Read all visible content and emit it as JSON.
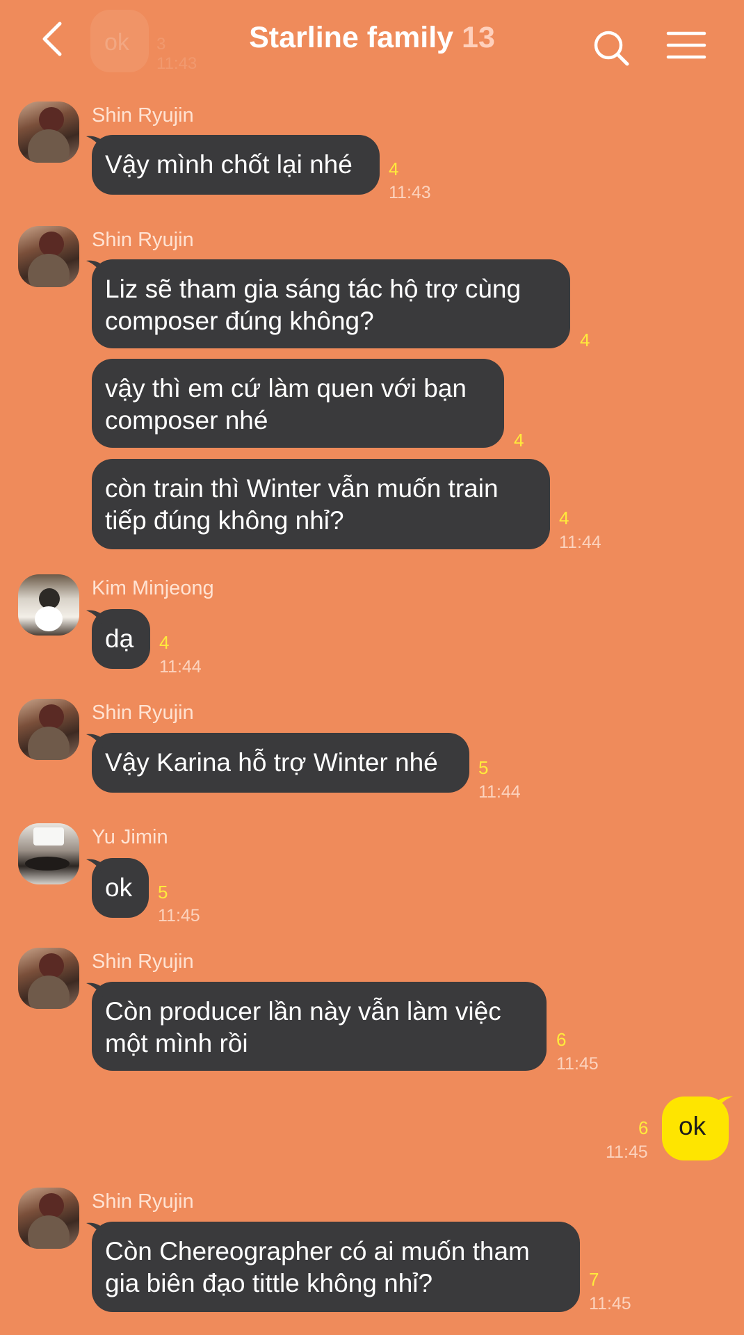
{
  "header": {
    "title": "Starline family",
    "member_count": "13",
    "ghost_bubble": "ok",
    "ghost_unread": "3",
    "ghost_time": "11:43"
  },
  "colors": {
    "background": "#EF8B5B",
    "other_bubble": "#3A3A3C",
    "my_bubble": "#FEE500",
    "unread": "#FFEA3C"
  },
  "messages": [
    {
      "sender": "Shin Ryujin",
      "text": "Vậy mình chốt lại nhé",
      "unread": "4",
      "time": "11:43"
    },
    {
      "sender": "Shin Ryujin",
      "text": [
        "Liz sẽ tham gia sáng tác hộ trợ cùng",
        "composer đúng không?"
      ],
      "unread": "4",
      "time": ""
    },
    {
      "sender": "",
      "text": [
        "vậy thì em cứ làm quen với bạn",
        "composer nhé"
      ],
      "unread": "4",
      "time": ""
    },
    {
      "sender": "",
      "text": [
        "còn train thì Winter vẫn muốn train",
        "tiếp đúng không nhỉ?"
      ],
      "unread": "4",
      "time": "11:44"
    },
    {
      "sender": "Kim Minjeong",
      "text": "dạ",
      "unread": "4",
      "time": "11:44"
    },
    {
      "sender": "Shin Ryujin",
      "text": "Vậy Karina hỗ trợ Winter nhé",
      "unread": "5",
      "time": "11:44"
    },
    {
      "sender": "Yu Jimin",
      "text": "ok",
      "unread": "5",
      "time": "11:45"
    },
    {
      "sender": "Shin Ryujin",
      "text": [
        "Còn producer lần này vẫn làm việc",
        "một mình rồi"
      ],
      "unread": "6",
      "time": "11:45"
    },
    {
      "sender": "me",
      "text": "ok",
      "unread": "6",
      "time": "11:45"
    },
    {
      "sender": "Shin Ryujin",
      "text": [
        "Còn Chereographer có ai muốn tham",
        "gia biên đạo tittle không nhỉ?"
      ],
      "unread": "7",
      "time": "11:45"
    }
  ]
}
